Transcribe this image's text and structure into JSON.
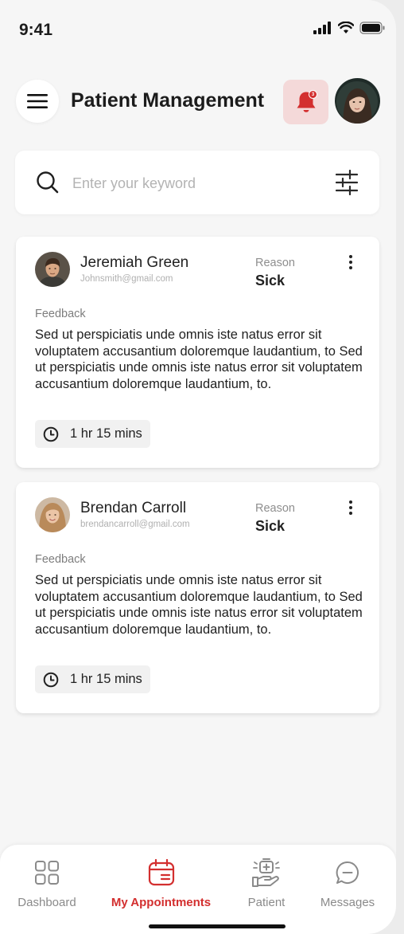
{
  "status_bar": {
    "time": "9:41"
  },
  "header": {
    "title": "Patient Management",
    "notification_count": "3"
  },
  "search": {
    "placeholder": "Enter your keyword"
  },
  "appointments": [
    {
      "name": "Jeremiah Green",
      "email": "Johnsmith@gmail.com",
      "reason_label": "Reason",
      "reason": "Sick",
      "feedback_label": "Feedback",
      "feedback": "Sed ut perspiciatis unde omnis iste natus error sit voluptatem accusantium doloremque laudantium, to Sed ut perspiciatis unde omnis iste natus error sit voluptatem accusantium doloremque laudantium, to.",
      "duration": "1 hr 15 mins"
    },
    {
      "name": "Brendan Carroll",
      "email": "brendancarroll@gmail.com",
      "reason_label": "Reason",
      "reason": "Sick",
      "feedback_label": "Feedback",
      "feedback": "Sed ut perspiciatis unde omnis iste natus error sit voluptatem accusantium doloremque laudantium, to Sed ut perspiciatis unde omnis iste natus error sit voluptatem accusantium doloremque laudantium, to.",
      "duration": "1 hr 15 mins"
    }
  ],
  "bottom_nav": [
    {
      "label": "Dashboard",
      "icon": "dashboard-grid-icon",
      "active": false
    },
    {
      "label": "My Appointments",
      "icon": "calendar-icon",
      "active": true
    },
    {
      "label": "Patient",
      "icon": "patient-care-icon",
      "active": false
    },
    {
      "label": "Messages",
      "icon": "chat-bubble-icon",
      "active": false
    }
  ],
  "colors": {
    "accent": "#d32f2f",
    "accent_soft": "#f4d9d9",
    "background": "#f6f6f6"
  }
}
